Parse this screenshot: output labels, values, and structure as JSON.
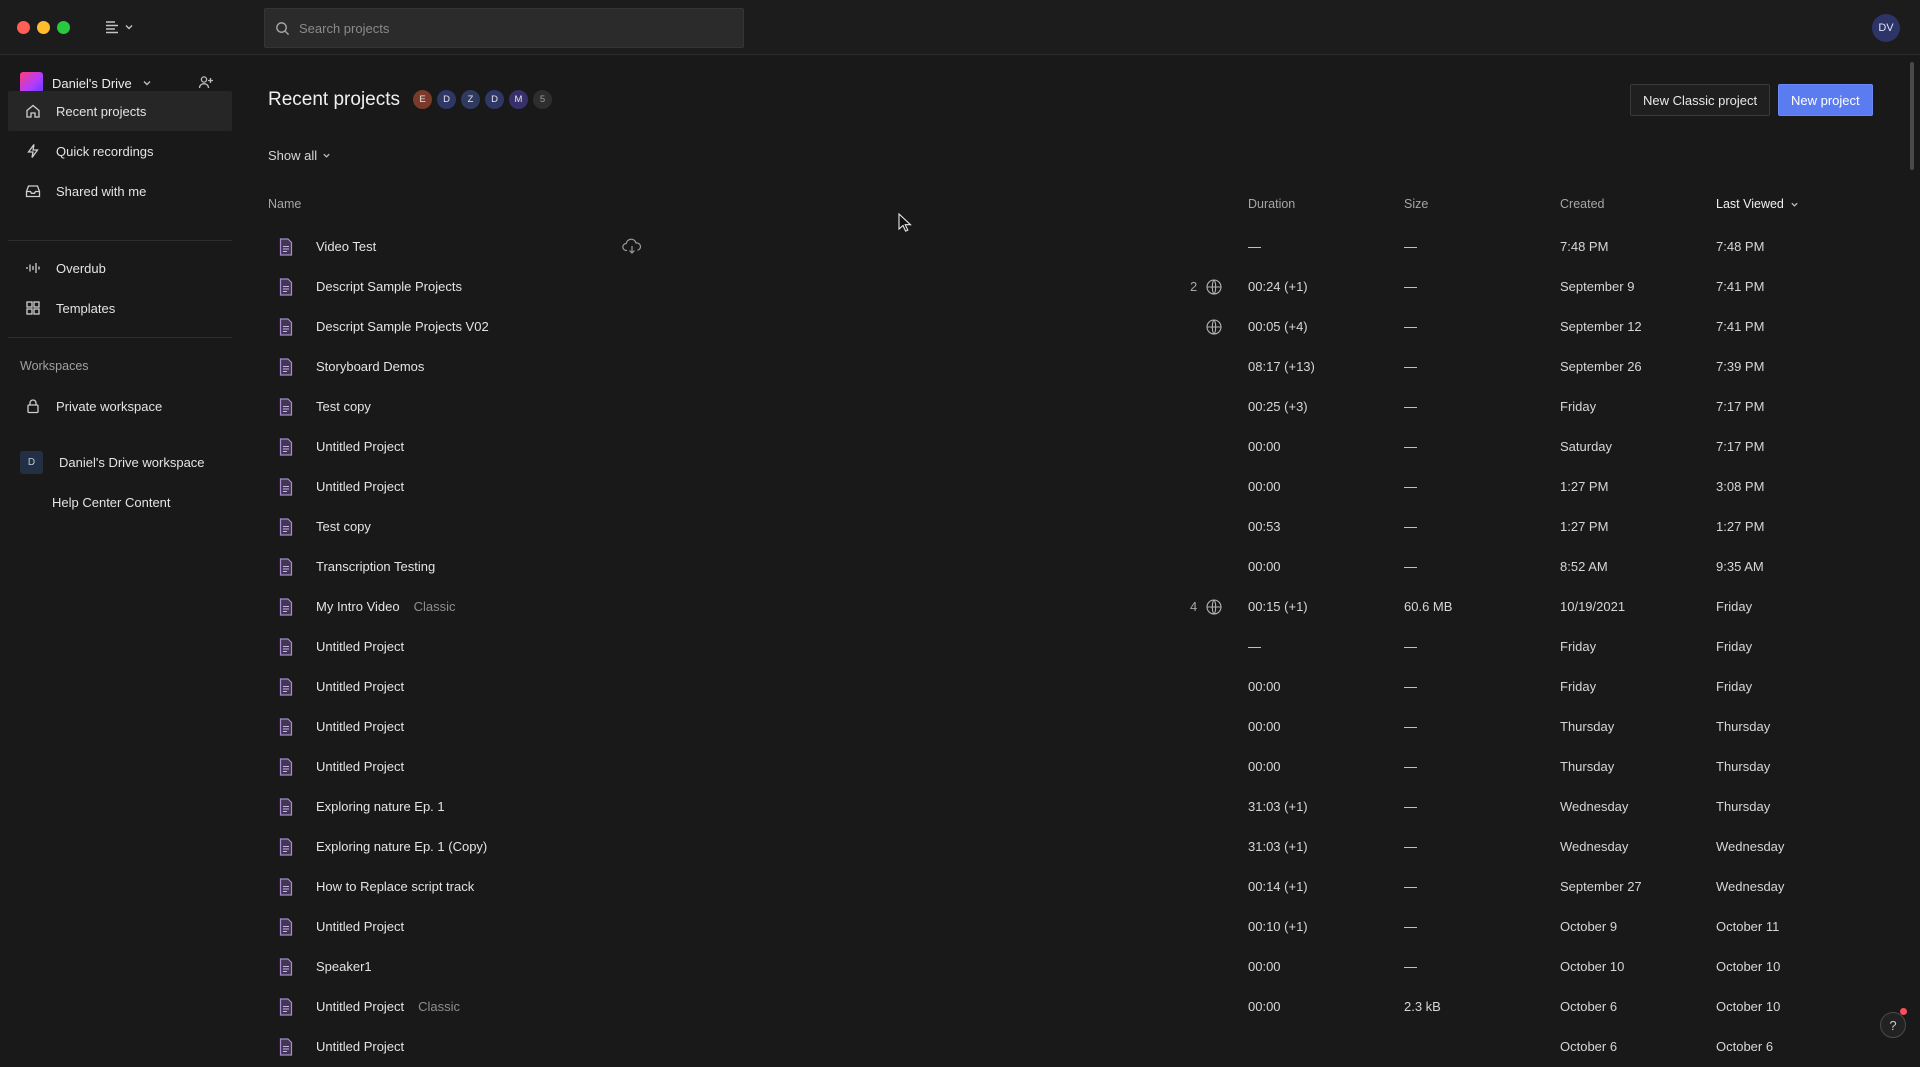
{
  "search": {
    "placeholder": "Search projects"
  },
  "user": {
    "initials": "DV"
  },
  "sidebar": {
    "drive_name": "Daniel's Drive",
    "nav": [
      {
        "label": "Recent projects",
        "icon": "home-icon",
        "active": true
      },
      {
        "label": "Quick recordings",
        "icon": "lightning-icon"
      },
      {
        "label": "Shared with me",
        "icon": "inbox-icon"
      },
      {
        "label": "Overdub",
        "icon": "waveform-icon"
      },
      {
        "label": "Templates",
        "icon": "grid-icon"
      }
    ],
    "workspaces_heading": "Workspaces",
    "workspaces": [
      {
        "label": "Private workspace",
        "icon": "lock-icon"
      },
      {
        "label": "Daniel's Drive workspace",
        "badge": "D"
      },
      {
        "label": "Help Center Content"
      }
    ]
  },
  "main": {
    "title": "Recent projects",
    "collaborators": [
      {
        "initial": "E",
        "color": "#7a3a2a"
      },
      {
        "initial": "D",
        "color": "#2e3766"
      },
      {
        "initial": "Z",
        "color": "#2f3a5e"
      },
      {
        "initial": "D",
        "color": "#2e3766"
      },
      {
        "initial": "M",
        "color": "#38306a"
      },
      {
        "initial": "5",
        "color": "#2e2e2e"
      }
    ],
    "new_classic_label": "New Classic project",
    "new_project_label": "New project",
    "show_all_label": "Show all",
    "columns": {
      "name": "Name",
      "duration": "Duration",
      "size": "Size",
      "created": "Created",
      "last_viewed": "Last Viewed"
    },
    "rows": [
      {
        "name": "Video Test",
        "cloud": true,
        "duration": "—",
        "size": "—",
        "created": "7:48 PM",
        "viewed": "7:48 PM"
      },
      {
        "name": "Descript Sample Projects",
        "shared_count": "2",
        "globe": true,
        "duration": "00:24 (+1)",
        "size": "—",
        "created": "September 9",
        "viewed": "7:41 PM"
      },
      {
        "name": "Descript Sample Projects V02",
        "globe": true,
        "duration": "00:05 (+4)",
        "size": "—",
        "created": "September 12",
        "viewed": "7:41 PM"
      },
      {
        "name": "Storyboard Demos",
        "duration": "08:17 (+13)",
        "size": "—",
        "created": "September 26",
        "viewed": "7:39 PM"
      },
      {
        "name": "Test copy",
        "duration": "00:25 (+3)",
        "size": "—",
        "created": "Friday",
        "viewed": "7:17 PM"
      },
      {
        "name": "Untitled Project",
        "duration": "00:00",
        "size": "—",
        "created": "Saturday",
        "viewed": "7:17 PM"
      },
      {
        "name": "Untitled Project",
        "duration": "00:00",
        "size": "—",
        "created": "1:27 PM",
        "viewed": "3:08 PM"
      },
      {
        "name": "Test copy",
        "duration": "00:53",
        "size": "—",
        "created": "1:27 PM",
        "viewed": "1:27 PM"
      },
      {
        "name": "Transcription Testing",
        "duration": "00:00",
        "size": "—",
        "created": "8:52 AM",
        "viewed": "9:35 AM"
      },
      {
        "name": "My Intro Video",
        "tag": "Classic",
        "shared_count": "4",
        "globe": true,
        "duration": "00:15 (+1)",
        "size": "60.6 MB",
        "created": "10/19/2021",
        "viewed": "Friday"
      },
      {
        "name": "Untitled Project",
        "duration": "—",
        "size": "—",
        "created": "Friday",
        "viewed": "Friday"
      },
      {
        "name": "Untitled Project",
        "duration": "00:00",
        "size": "—",
        "created": "Friday",
        "viewed": "Friday"
      },
      {
        "name": "Untitled Project",
        "duration": "00:00",
        "size": "—",
        "created": "Thursday",
        "viewed": "Thursday"
      },
      {
        "name": "Untitled Project",
        "duration": "00:00",
        "size": "—",
        "created": "Thursday",
        "viewed": "Thursday"
      },
      {
        "name": "Exploring nature Ep. 1",
        "duration": "31:03 (+1)",
        "size": "—",
        "created": "Wednesday",
        "viewed": "Thursday"
      },
      {
        "name": "Exploring nature Ep. 1 (Copy)",
        "duration": "31:03 (+1)",
        "size": "—",
        "created": "Wednesday",
        "viewed": "Wednesday"
      },
      {
        "name": "How to Replace script track",
        "duration": "00:14 (+1)",
        "size": "—",
        "created": "September 27",
        "viewed": "Wednesday"
      },
      {
        "name": "Untitled Project",
        "duration": "00:10 (+1)",
        "size": "—",
        "created": "October 9",
        "viewed": "October 11"
      },
      {
        "name": "Speaker1",
        "duration": "00:00",
        "size": "—",
        "created": "October 10",
        "viewed": "October 10"
      },
      {
        "name": "Untitled Project",
        "tag": "Classic",
        "duration": "00:00",
        "size": "2.3 kB",
        "created": "October 6",
        "viewed": "October 10"
      },
      {
        "name": "Untitled Project",
        "duration": "",
        "size": "",
        "created": "October 6",
        "viewed": "October 6"
      }
    ]
  },
  "help_label": "?"
}
